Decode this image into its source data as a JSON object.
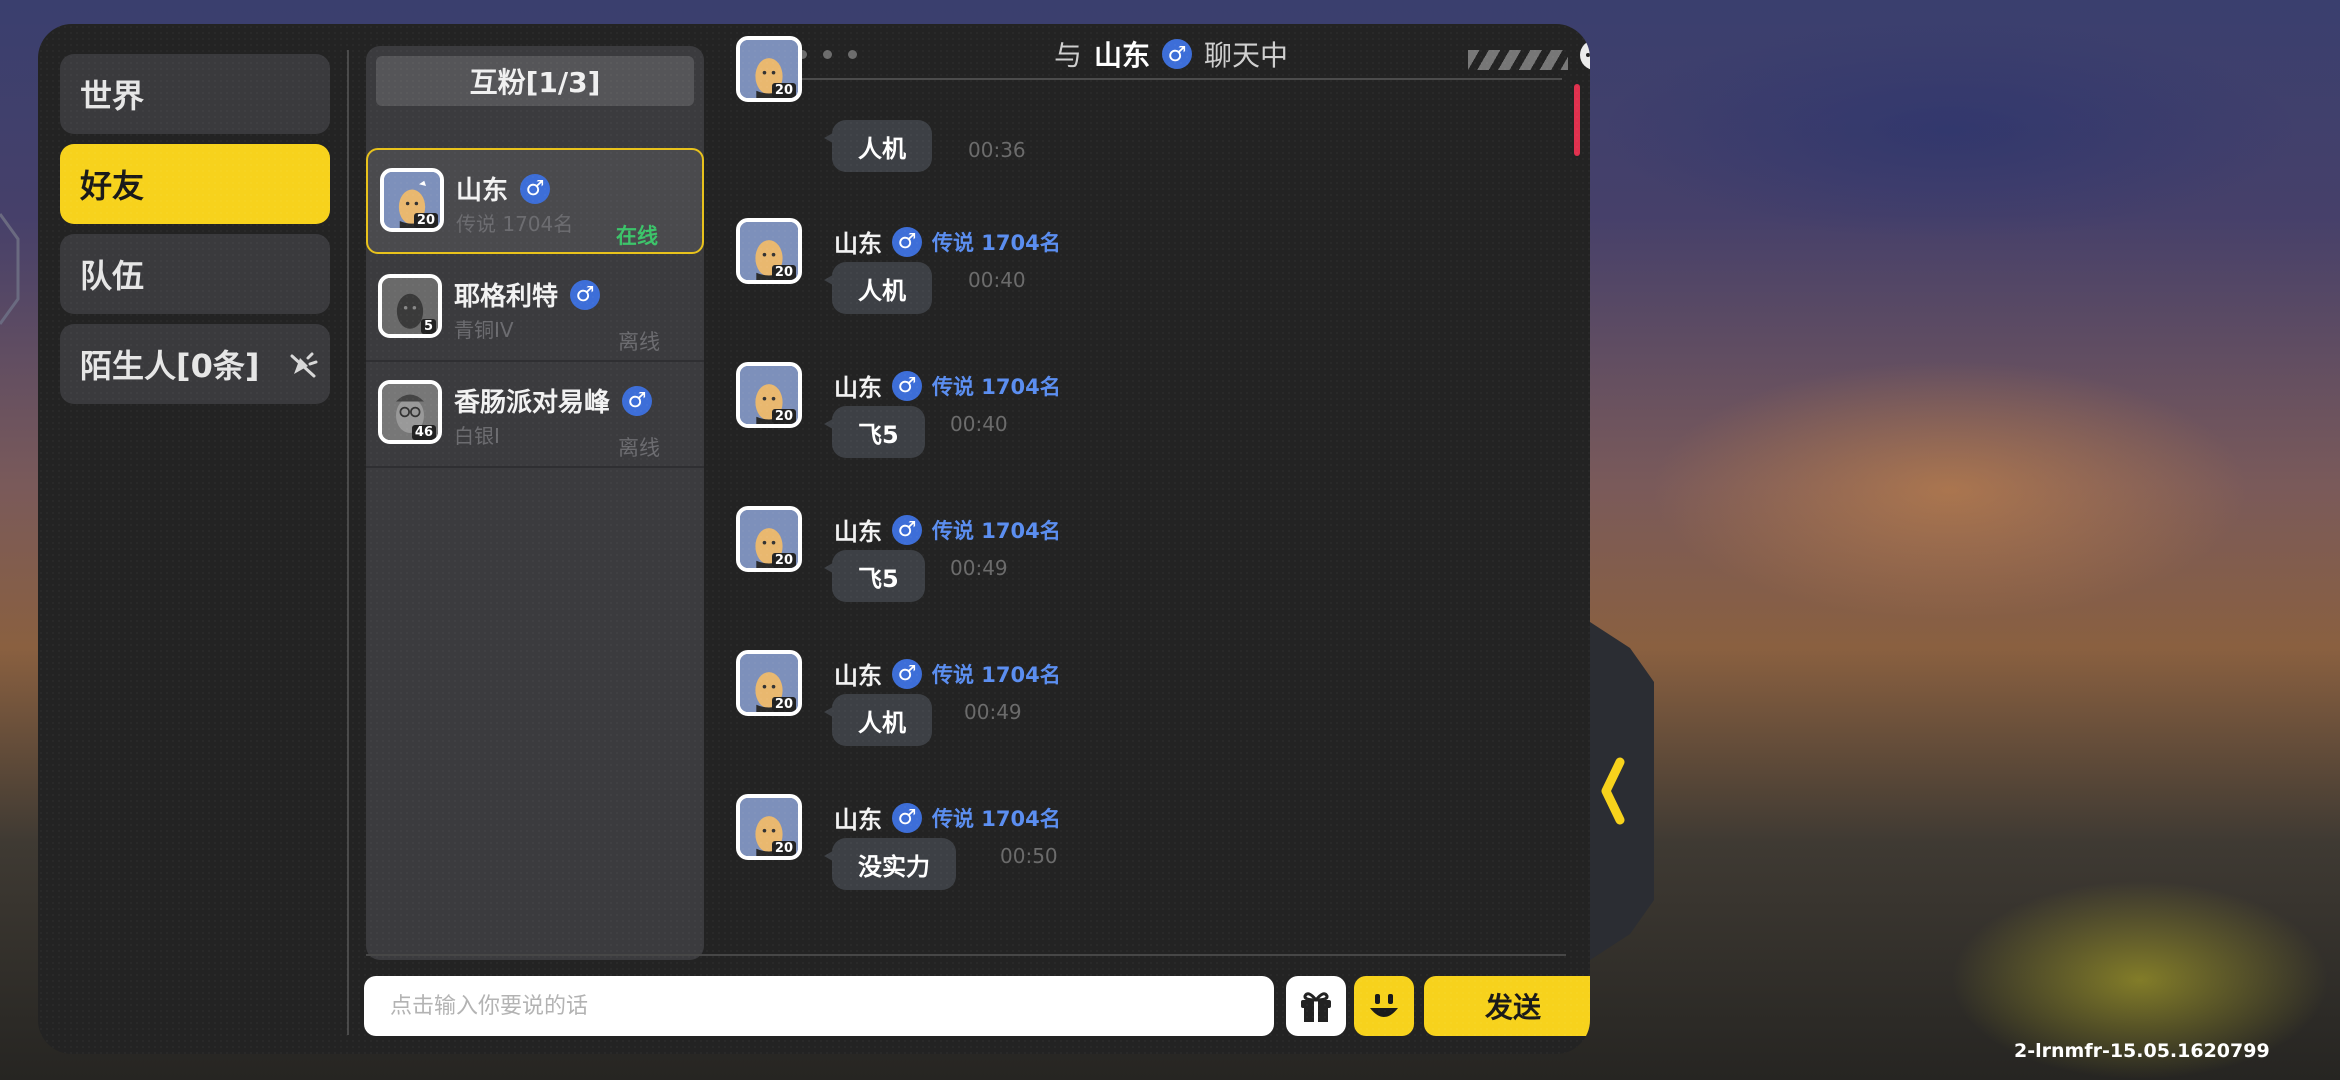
{
  "sidebar": {
    "tabs": [
      {
        "label": "世界"
      },
      {
        "label": "好友"
      },
      {
        "label": "队伍"
      },
      {
        "label": "陌生人[0条]"
      }
    ]
  },
  "friends": {
    "header": "互粉[1/3]",
    "items": [
      {
        "name": "山东",
        "rank": "传说 1704名",
        "status": "在线",
        "level": "20"
      },
      {
        "name": "耶格利特",
        "rank": "青铜IV",
        "status": "离线",
        "level": "5"
      },
      {
        "name": "香肠派对易峰",
        "rank": "白银I",
        "status": "离线",
        "level": "46"
      }
    ]
  },
  "chat": {
    "header_prefix": "与",
    "header_name": "山东",
    "header_suffix": "聊天中",
    "gender_symbol": "♂",
    "messages": [
      {
        "name": "",
        "rank": "",
        "text": "人机",
        "time": "00:36",
        "level": "20"
      },
      {
        "name": "山东",
        "rank": "传说 1704名",
        "text": "人机",
        "time": "00:40",
        "level": "20"
      },
      {
        "name": "山东",
        "rank": "传说 1704名",
        "text": "飞5",
        "time": "00:40",
        "level": "20"
      },
      {
        "name": "山东",
        "rank": "传说 1704名",
        "text": "飞5",
        "time": "00:49",
        "level": "20"
      },
      {
        "name": "山东",
        "rank": "传说 1704名",
        "text": "人机",
        "time": "00:49",
        "level": "20"
      },
      {
        "name": "山东",
        "rank": "传说 1704名",
        "text": "没实力",
        "time": "00:50",
        "level": "20"
      }
    ]
  },
  "input": {
    "placeholder": "点击输入你要说的话",
    "send_label": "发送"
  },
  "version": "2-lrnmfr-15.05.1620799",
  "colors": {
    "accent": "#f7d21c",
    "online": "#3cc46a",
    "rank": "#5b8ef0",
    "male_badge": "#3d6ed8"
  }
}
